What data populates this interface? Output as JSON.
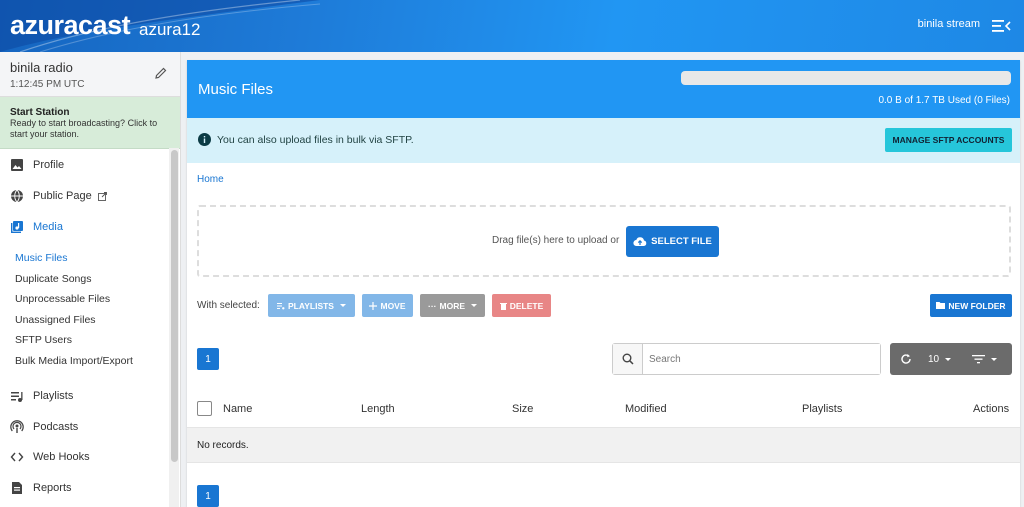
{
  "header": {
    "brand": "azuracast",
    "instance": "azura12",
    "user": "binila stream",
    "menu_icon": "menu-collapse-icon"
  },
  "station": {
    "name": "binila radio",
    "time": "1:12:45 PM UTC",
    "start_title": "Start Station",
    "start_desc": "Ready to start broadcasting? Click to start your station."
  },
  "nav": {
    "profile": "Profile",
    "public_page": "Public Page",
    "media": "Media",
    "media_sub": [
      "Music Files",
      "Duplicate Songs",
      "Unprocessable Files",
      "Unassigned Files",
      "SFTP Users",
      "Bulk Media Import/Export"
    ],
    "playlists": "Playlists",
    "podcasts": "Podcasts",
    "webhooks": "Web Hooks",
    "reports": "Reports"
  },
  "main": {
    "title": "Music Files",
    "quota_text": "0.0 B of 1.7 TB Used (0 Files)",
    "quota_fraction": 0,
    "info_text": "You can also upload files in bulk via SFTP.",
    "sftp_button": "MANAGE SFTP ACCOUNTS",
    "breadcrumb": "Home",
    "drop_text": "Drag file(s) here to upload or",
    "select_file": "SELECT FILE",
    "with_selected": "With selected:",
    "actions": {
      "playlists": "PLAYLISTS",
      "move": "MOVE",
      "more": "MORE",
      "delete": "DELETE",
      "new_folder": "NEW FOLDER"
    },
    "page_number": "1",
    "search_placeholder": "Search",
    "per_page": "10",
    "columns": [
      "Name",
      "Length",
      "Size",
      "Modified",
      "Playlists",
      "Actions"
    ],
    "empty": "No records."
  },
  "colors": {
    "primary": "#2196f3",
    "button_blue": "#1976d2",
    "info_bg": "#d6f1fa",
    "start_bg": "#d7ecd9",
    "sftp_button": "#26c6da"
  }
}
